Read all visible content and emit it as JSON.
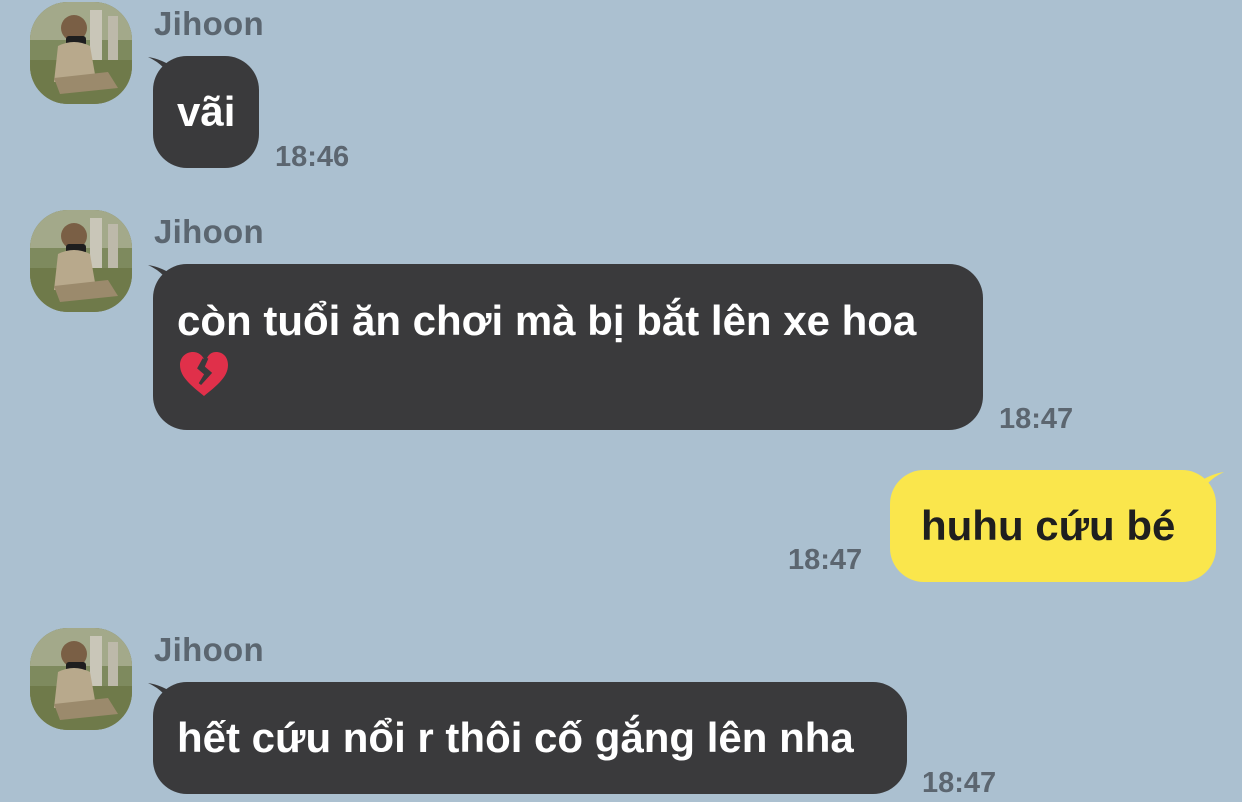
{
  "messages": [
    {
      "sender": "Jihoon",
      "text": "vãi",
      "time": "18:46"
    },
    {
      "sender": "Jihoon",
      "text": "còn tuổi ăn chơi mà bị bắt lên xe hoa",
      "emoji": "broken-heart-icon",
      "time": "18:47"
    },
    {
      "text": "huhu cứu bé",
      "time": "18:47"
    },
    {
      "sender": "Jihoon",
      "text": "hết cứu nổi r thôi cố gắng lên nha",
      "time": "18:47"
    }
  ],
  "colors": {
    "background": "#abc0d0",
    "incoming_bubble": "#3a3a3c",
    "outgoing_bubble": "#fae64c",
    "meta_text": "#5c6670"
  }
}
